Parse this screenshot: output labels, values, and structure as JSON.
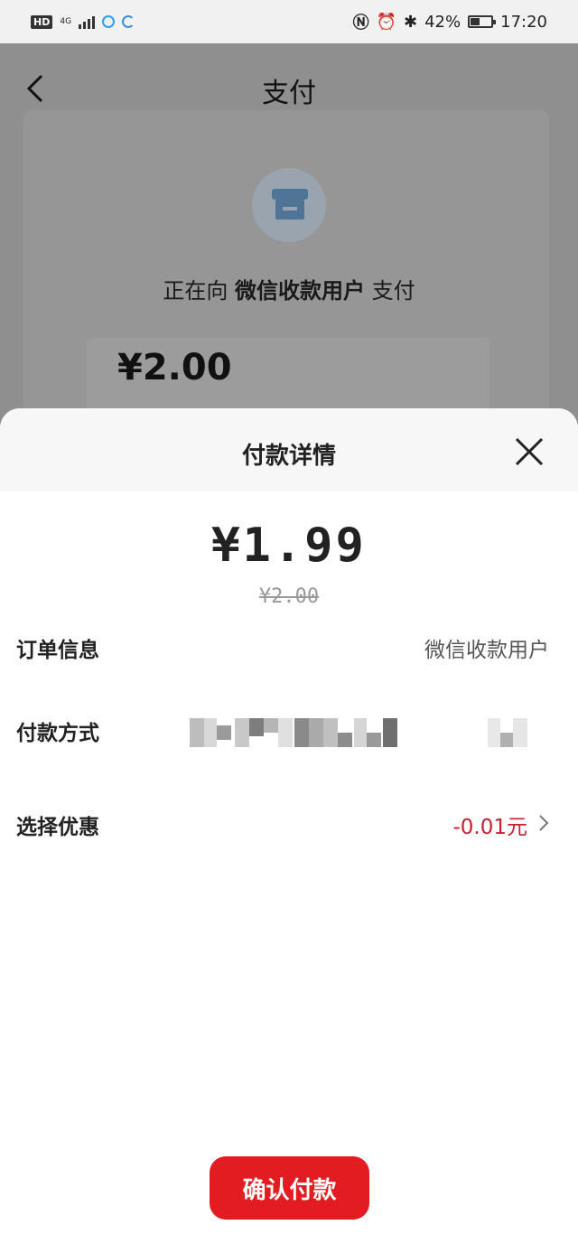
{
  "status_bar": {
    "hd_label": "HD",
    "network_label": "4G",
    "battery_text": "42%",
    "time": "17:20"
  },
  "background_page": {
    "title": "支付",
    "pay_prefix": "正在向",
    "payee": "微信收款用户",
    "pay_suffix": "支付",
    "amount": "¥2.00"
  },
  "sheet": {
    "title": "付款详情",
    "amount": "¥1.99",
    "original_amount": "¥2.00",
    "rows": [
      {
        "label": "订单信息",
        "value": "微信收款用户"
      },
      {
        "label": "付款方式",
        "value": ""
      },
      {
        "label": "选择优惠",
        "value": "-0.01元"
      }
    ],
    "confirm_label": "确认付款"
  },
  "colors": {
    "accent_red": "#e31c22",
    "discount_red": "#c8202e"
  }
}
